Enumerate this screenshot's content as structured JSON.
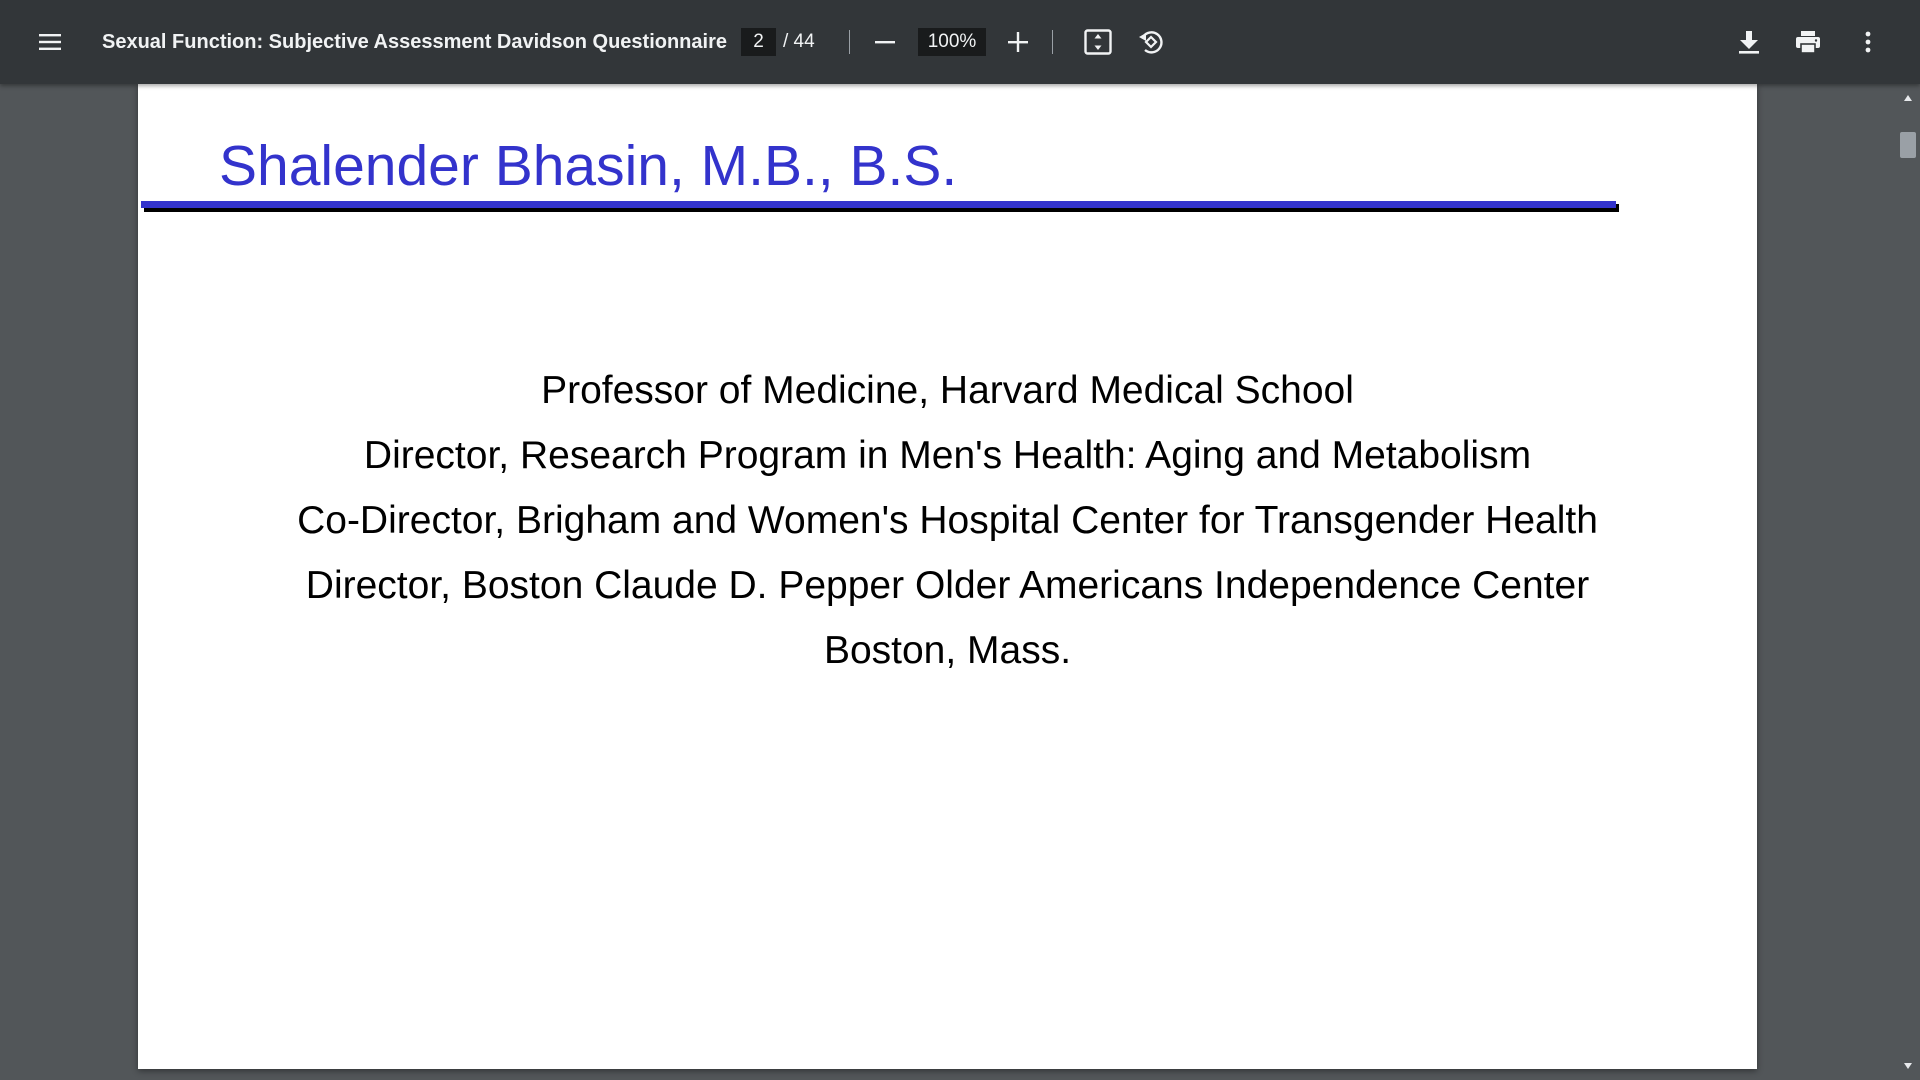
{
  "toolbar": {
    "document_title": "Sexual Function: Subjective Assessment Davidson Questionnaire",
    "current_page": "2",
    "page_total": "/ 44",
    "zoom_level": "100%"
  },
  "icons": {
    "menu": "menu-icon",
    "zoom_out": "minus-icon",
    "zoom_in": "plus-icon",
    "fit": "fit-to-page-icon",
    "rotate": "rotate-icon",
    "download": "download-icon",
    "print": "print-icon",
    "more": "more-vert-icon"
  },
  "page": {
    "title": "Shalender Bhasin, M.B., B.S.",
    "affiliations": [
      "Professor of Medicine, Harvard Medical School",
      "Director, Research Program in Men's Health: Aging and Metabolism",
      "Co-Director, Brigham and Women's Hospital Center for Transgender Health",
      "Director, Boston Claude D. Pepper Older Americans Independence Center",
      "Boston, Mass."
    ]
  },
  "colors": {
    "toolbar_bg": "#323639",
    "viewer_bg": "#525659",
    "title_blue": "#3333cc"
  }
}
